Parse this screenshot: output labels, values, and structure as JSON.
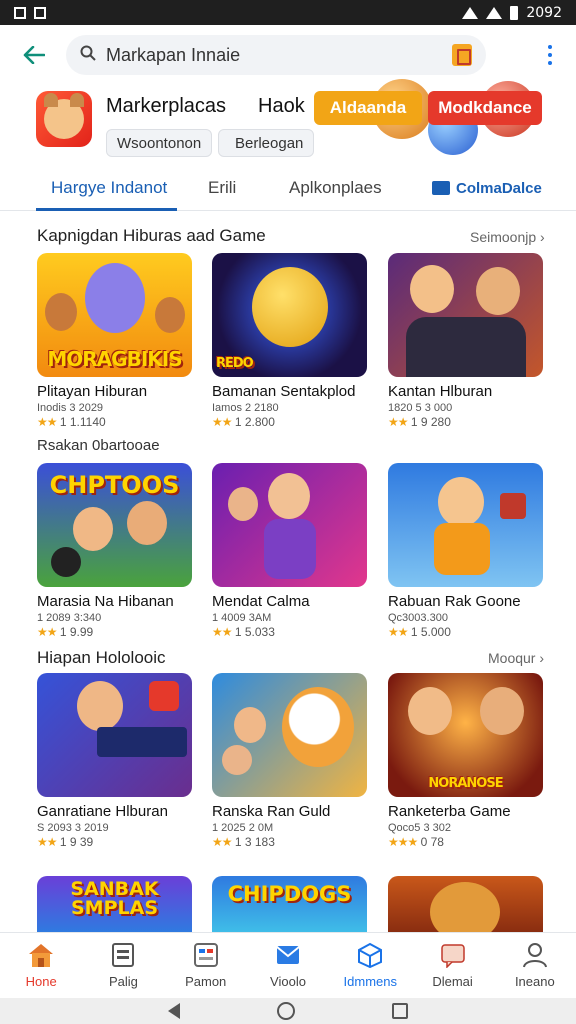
{
  "status": {
    "time": "2092"
  },
  "search": {
    "query": "Markapan Innaie"
  },
  "app": {
    "title": "Markerplacas",
    "hack": "Haok",
    "btn_yellow": "Aldaanda",
    "btn_red": "Modkdance",
    "chip_1": "Wsoontonon",
    "chip_2": "Berleogan"
  },
  "tabs": [
    {
      "label": "Hargye Indanot"
    },
    {
      "label": "Erili"
    },
    {
      "label": "Aplkonplaes"
    },
    {
      "label": "ColmaDalce"
    }
  ],
  "sections": [
    {
      "title": "Kapnigdan Hiburas  aad Game",
      "link": "Seimoonjp ›"
    },
    {
      "title": "Hiapan Hololooic",
      "link": "Mooqur ›"
    }
  ],
  "subheading": "Rsakan 0bartooae",
  "cards": [
    {
      "banner": "MORAGBIKIS",
      "title": "Plitayan Hiburan",
      "meta": "Inodis 3 2029",
      "rating": "1 1.1140",
      "stars": "★★"
    },
    {
      "banner": "REDO",
      "title": "Bamanan Sentakplod",
      "meta": "Iamos 2 2180",
      "rating": "1 2.800",
      "stars": "★★"
    },
    {
      "banner": "",
      "title": "Kantan Hlburan",
      "meta": "1820 5 3 000",
      "rating": "1 9 280",
      "stars": "★★"
    },
    {
      "banner": "CHPTOOS",
      "title": "Marasia Na Hibanan",
      "meta": "1 2089 3:340",
      "rating": "1 9.99",
      "stars": "★★"
    },
    {
      "banner": "",
      "title": "Mendat Calma",
      "meta": "1 4009 3AM",
      "rating": "1 5.033",
      "stars": "★★"
    },
    {
      "banner": "",
      "title": "Rabuan Rak Goone",
      "meta": "Qc3003.300",
      "rating": "1 5.000",
      "stars": "★★"
    },
    {
      "banner": "",
      "title": "Ganratiane Hlburan",
      "meta": "S 2093 3 2019",
      "rating": "1 9 39",
      "stars": "★★"
    },
    {
      "banner": "",
      "title": "Ranska Ran Guld",
      "meta": "1 2025 2 0M",
      "rating": "1 3 183",
      "stars": "★★"
    },
    {
      "banner": "NORANOSE",
      "title": "Ranketerba Game",
      "meta": "Qoco5 3 302",
      "rating": "0 78",
      "stars": "★★★"
    },
    {
      "banner": "SANBAK SMPLAS",
      "title": "",
      "meta": "",
      "rating": "",
      "stars": ""
    },
    {
      "banner": "CHIPDOGS",
      "title": "",
      "meta": "",
      "rating": "",
      "stars": ""
    },
    {
      "banner": "",
      "title": "",
      "meta": "",
      "rating": "",
      "stars": ""
    }
  ],
  "nav": [
    {
      "label": "Hone",
      "icon": "home-icon"
    },
    {
      "label": "Palig",
      "icon": "document-icon"
    },
    {
      "label": "Pamon",
      "icon": "board-icon"
    },
    {
      "label": "Vioolo",
      "icon": "mail-icon"
    },
    {
      "label": "Idmmens",
      "icon": "box-icon"
    },
    {
      "label": "Dlemai",
      "icon": "chat-icon"
    },
    {
      "label": "Ineano",
      "icon": "person-icon"
    }
  ],
  "colors": {
    "accent_blue": "#1a5fb4",
    "accent_red": "#e5392b",
    "accent_yellow": "#f2a516"
  }
}
